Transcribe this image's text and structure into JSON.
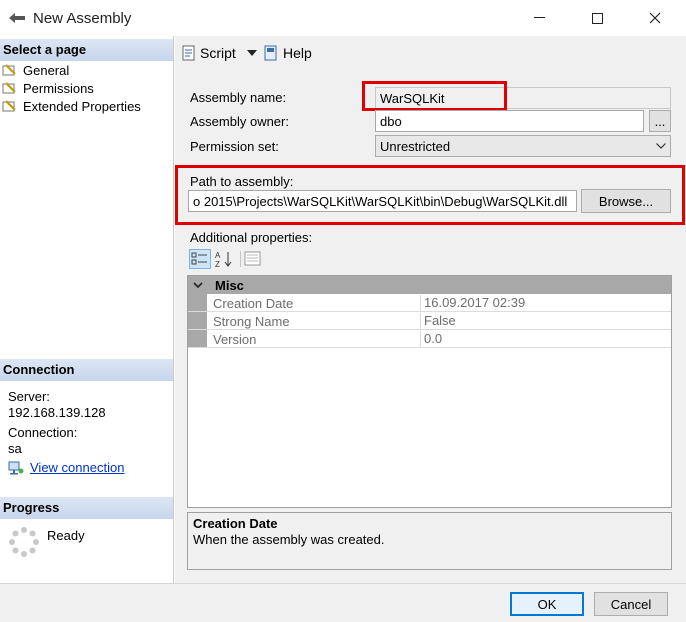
{
  "window": {
    "title": "New Assembly",
    "minimize": "—",
    "maximize": "☐",
    "close": "✕"
  },
  "sidebar": {
    "select_page_header": "Select a page",
    "pages": [
      {
        "label": "General"
      },
      {
        "label": "Permissions"
      },
      {
        "label": "Extended Properties"
      }
    ],
    "connection_header": "Connection",
    "server_label": "Server:",
    "server_value": "192.168.139.128",
    "connection_label": "Connection:",
    "connection_value": "sa",
    "view_connection": "View connection",
    "progress_header": "Progress",
    "progress_status": "Ready"
  },
  "toolbar": {
    "script_label": "Script",
    "help_label": "Help"
  },
  "form": {
    "assembly_name_label": "Assembly name:",
    "assembly_name_value": "WarSQLKit",
    "assembly_owner_label": "Assembly owner:",
    "assembly_owner_value": "dbo",
    "owner_browse": "...",
    "permission_set_label": "Permission set:",
    "permission_set_value": "Unrestricted",
    "path_label": "Path to assembly:",
    "path_value": "o 2015\\Projects\\WarSQLKit\\WarSQLKit\\bin\\Debug\\WarSQLKit.dll",
    "browse_label": "Browse...",
    "additional_label": "Additional properties:"
  },
  "property_grid": {
    "category": "Misc",
    "rows": [
      {
        "name": "Creation Date",
        "value": "16.09.2017 02:39"
      },
      {
        "name": "Strong Name",
        "value": "False"
      },
      {
        "name": "Version",
        "value": "0.0"
      }
    ],
    "description_title": "Creation Date",
    "description_text": "When the assembly was created."
  },
  "footer": {
    "ok_label": "OK",
    "cancel_label": "Cancel"
  },
  "colors": {
    "highlight": "#e00000",
    "accent": "#0078d7",
    "link": "#0033cc"
  }
}
